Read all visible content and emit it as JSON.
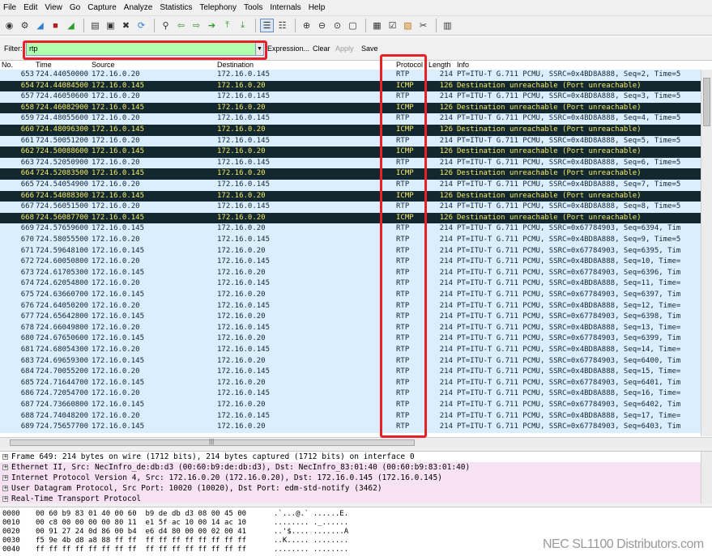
{
  "menu": [
    "File",
    "Edit",
    "View",
    "Go",
    "Capture",
    "Analyze",
    "Statistics",
    "Telephony",
    "Tools",
    "Internals",
    "Help"
  ],
  "filter": {
    "label": "Filter:",
    "value": "rtp",
    "expression": "Expression...",
    "clear": "Clear",
    "apply": "Apply",
    "save": "Save"
  },
  "columns": {
    "no": "No.",
    "time": "Time",
    "source": "Source",
    "destination": "Destination",
    "protocol": "Protocol",
    "length": "Length",
    "info": "Info"
  },
  "packets": [
    {
      "no": "653",
      "time": "724.44050000",
      "src": "172.16.0.20",
      "dst": "172.16.0.145",
      "proto": "RTP",
      "len": "214",
      "info": "PT=ITU-T G.711 PCMU, SSRC=0x4BD8A888, Seq=2, Time=5"
    },
    {
      "no": "654",
      "time": "724.44084500",
      "src": "172.16.0.145",
      "dst": "172.16.0.20",
      "proto": "ICMP",
      "len": "126",
      "info": "Destination unreachable (Port unreachable)"
    },
    {
      "no": "657",
      "time": "724.46050600",
      "src": "172.16.0.20",
      "dst": "172.16.0.145",
      "proto": "RTP",
      "len": "214",
      "info": "PT=ITU-T G.711 PCMU, SSRC=0x4BD8A888, Seq=3, Time=5"
    },
    {
      "no": "658",
      "time": "724.46082900",
      "src": "172.16.0.145",
      "dst": "172.16.0.20",
      "proto": "ICMP",
      "len": "126",
      "info": "Destination unreachable (Port unreachable)"
    },
    {
      "no": "659",
      "time": "724.48055600",
      "src": "172.16.0.20",
      "dst": "172.16.0.145",
      "proto": "RTP",
      "len": "214",
      "info": "PT=ITU-T G.711 PCMU, SSRC=0x4BD8A888, Seq=4, Time=5"
    },
    {
      "no": "660",
      "time": "724.48096300",
      "src": "172.16.0.145",
      "dst": "172.16.0.20",
      "proto": "ICMP",
      "len": "126",
      "info": "Destination unreachable (Port unreachable)"
    },
    {
      "no": "661",
      "time": "724.50051200",
      "src": "172.16.0.20",
      "dst": "172.16.0.145",
      "proto": "RTP",
      "len": "214",
      "info": "PT=ITU-T G.711 PCMU, SSRC=0x4BD8A888, Seq=5, Time=5"
    },
    {
      "no": "662",
      "time": "724.50088600",
      "src": "172.16.0.145",
      "dst": "172.16.0.20",
      "proto": "ICMP",
      "len": "126",
      "info": "Destination unreachable (Port unreachable)"
    },
    {
      "no": "663",
      "time": "724.52050900",
      "src": "172.16.0.20",
      "dst": "172.16.0.145",
      "proto": "RTP",
      "len": "214",
      "info": "PT=ITU-T G.711 PCMU, SSRC=0x4BD8A888, Seq=6, Time=5"
    },
    {
      "no": "664",
      "time": "724.52083500",
      "src": "172.16.0.145",
      "dst": "172.16.0.20",
      "proto": "ICMP",
      "len": "126",
      "info": "Destination unreachable (Port unreachable)"
    },
    {
      "no": "665",
      "time": "724.54054900",
      "src": "172.16.0.20",
      "dst": "172.16.0.145",
      "proto": "RTP",
      "len": "214",
      "info": "PT=ITU-T G.711 PCMU, SSRC=0x4BD8A888, Seq=7, Time=5"
    },
    {
      "no": "666",
      "time": "724.54088300",
      "src": "172.16.0.145",
      "dst": "172.16.0.20",
      "proto": "ICMP",
      "len": "126",
      "info": "Destination unreachable (Port unreachable)"
    },
    {
      "no": "667",
      "time": "724.56051500",
      "src": "172.16.0.20",
      "dst": "172.16.0.145",
      "proto": "RTP",
      "len": "214",
      "info": "PT=ITU-T G.711 PCMU, SSRC=0x4BD8A888, Seq=8, Time=5"
    },
    {
      "no": "668",
      "time": "724.56087700",
      "src": "172.16.0.145",
      "dst": "172.16.0.20",
      "proto": "ICMP",
      "len": "126",
      "info": "Destination unreachable (Port unreachable)"
    },
    {
      "no": "669",
      "time": "724.57659600",
      "src": "172.16.0.145",
      "dst": "172.16.0.20",
      "proto": "RTP",
      "len": "214",
      "info": "PT=ITU-T G.711 PCMU, SSRC=0x67784903, Seq=6394, Tim"
    },
    {
      "no": "670",
      "time": "724.58055500",
      "src": "172.16.0.20",
      "dst": "172.16.0.145",
      "proto": "RTP",
      "len": "214",
      "info": "PT=ITU-T G.711 PCMU, SSRC=0x4BD8A888, Seq=9, Time=5"
    },
    {
      "no": "671",
      "time": "724.59648100",
      "src": "172.16.0.145",
      "dst": "172.16.0.20",
      "proto": "RTP",
      "len": "214",
      "info": "PT=ITU-T G.711 PCMU, SSRC=0x67784903, Seq=6395, Tim"
    },
    {
      "no": "672",
      "time": "724.60050800",
      "src": "172.16.0.20",
      "dst": "172.16.0.145",
      "proto": "RTP",
      "len": "214",
      "info": "PT=ITU-T G.711 PCMU, SSRC=0x4BD8A888, Seq=10, Time="
    },
    {
      "no": "673",
      "time": "724.61705300",
      "src": "172.16.0.145",
      "dst": "172.16.0.20",
      "proto": "RTP",
      "len": "214",
      "info": "PT=ITU-T G.711 PCMU, SSRC=0x67784903, Seq=6396, Tim"
    },
    {
      "no": "674",
      "time": "724.62054800",
      "src": "172.16.0.20",
      "dst": "172.16.0.145",
      "proto": "RTP",
      "len": "214",
      "info": "PT=ITU-T G.711 PCMU, SSRC=0x4BD8A888, Seq=11, Time="
    },
    {
      "no": "675",
      "time": "724.63660700",
      "src": "172.16.0.145",
      "dst": "172.16.0.20",
      "proto": "RTP",
      "len": "214",
      "info": "PT=ITU-T G.711 PCMU, SSRC=0x67784903, Seq=6397, Tim"
    },
    {
      "no": "676",
      "time": "724.64050200",
      "src": "172.16.0.20",
      "dst": "172.16.0.145",
      "proto": "RTP",
      "len": "214",
      "info": "PT=ITU-T G.711 PCMU, SSRC=0x4BD8A888, Seq=12, Time="
    },
    {
      "no": "677",
      "time": "724.65642800",
      "src": "172.16.0.145",
      "dst": "172.16.0.20",
      "proto": "RTP",
      "len": "214",
      "info": "PT=ITU-T G.711 PCMU, SSRC=0x67784903, Seq=6398, Tim"
    },
    {
      "no": "678",
      "time": "724.66049800",
      "src": "172.16.0.20",
      "dst": "172.16.0.145",
      "proto": "RTP",
      "len": "214",
      "info": "PT=ITU-T G.711 PCMU, SSRC=0x4BD8A888, Seq=13, Time="
    },
    {
      "no": "680",
      "time": "724.67650600",
      "src": "172.16.0.145",
      "dst": "172.16.0.20",
      "proto": "RTP",
      "len": "214",
      "info": "PT=ITU-T G.711 PCMU, SSRC=0x67784903, Seq=6399, Tim"
    },
    {
      "no": "681",
      "time": "724.68054300",
      "src": "172.16.0.20",
      "dst": "172.16.0.145",
      "proto": "RTP",
      "len": "214",
      "info": "PT=ITU-T G.711 PCMU, SSRC=0x4BD8A888, Seq=14, Time="
    },
    {
      "no": "683",
      "time": "724.69659300",
      "src": "172.16.0.145",
      "dst": "172.16.0.20",
      "proto": "RTP",
      "len": "214",
      "info": "PT=ITU-T G.711 PCMU, SSRC=0x67784903, Seq=6400, Tim"
    },
    {
      "no": "684",
      "time": "724.70055200",
      "src": "172.16.0.20",
      "dst": "172.16.0.145",
      "proto": "RTP",
      "len": "214",
      "info": "PT=ITU-T G.711 PCMU, SSRC=0x4BD8A888, Seq=15, Time="
    },
    {
      "no": "685",
      "time": "724.71644700",
      "src": "172.16.0.145",
      "dst": "172.16.0.20",
      "proto": "RTP",
      "len": "214",
      "info": "PT=ITU-T G.711 PCMU, SSRC=0x67784903, Seq=6401, Tim"
    },
    {
      "no": "686",
      "time": "724.72054700",
      "src": "172.16.0.20",
      "dst": "172.16.0.145",
      "proto": "RTP",
      "len": "214",
      "info": "PT=ITU-T G.711 PCMU, SSRC=0x4BD8A888, Seq=16, Time="
    },
    {
      "no": "687",
      "time": "724.73660800",
      "src": "172.16.0.145",
      "dst": "172.16.0.20",
      "proto": "RTP",
      "len": "214",
      "info": "PT=ITU-T G.711 PCMU, SSRC=0x67784903, Seq=6402, Tim"
    },
    {
      "no": "688",
      "time": "724.74048200",
      "src": "172.16.0.20",
      "dst": "172.16.0.145",
      "proto": "RTP",
      "len": "214",
      "info": "PT=ITU-T G.711 PCMU, SSRC=0x4BD8A888, Seq=17, Time="
    },
    {
      "no": "689",
      "time": "724.75657700",
      "src": "172.16.0.145",
      "dst": "172.16.0.20",
      "proto": "RTP",
      "len": "214",
      "info": "PT=ITU-T G.711 PCMU, SSRC=0x67784903, Seq=6403, Tim"
    }
  ],
  "details": [
    "Frame 649: 214 bytes on wire (1712 bits), 214 bytes captured (1712 bits) on interface 0",
    "Ethernet II, Src: NecInfro_de:db:d3 (00:60:b9:de:db:d3), Dst: NecInfro_83:01:40 (00:60:b9:83:01:40)",
    "Internet Protocol Version 4, Src: 172.16.0.20 (172.16.0.20), Dst: 172.16.0.145 (172.16.0.145)",
    "User Datagram Protocol, Src Port: 10020 (10020), Dst Port: edm-std-notify (3462)",
    "Real-Time Transport Protocol"
  ],
  "bytes": [
    {
      "off": "0000",
      "hex": "00 60 b9 83 01 40 00 60  b9 de db d3 08 00 45 00",
      "ascii": ".`...@.` ......E."
    },
    {
      "off": "0010",
      "hex": "00 c8 00 00 00 00 80 11  e1 5f ac 10 00 14 ac 10",
      "ascii": "........ ._......"
    },
    {
      "off": "0020",
      "hex": "00 91 27 24 0d 86 00 b4  e6 d4 80 00 00 02 00 41",
      "ascii": "..'$.... .......A"
    },
    {
      "off": "0030",
      "hex": "f5 9e 4b d8 a8 88 ff ff  ff ff ff ff ff ff ff ff",
      "ascii": "..K..... ........"
    },
    {
      "off": "0040",
      "hex": "ff ff ff ff ff ff ff ff  ff ff ff ff ff ff ff ff",
      "ascii": "........ ........"
    }
  ],
  "watermark": "NEC SL1100 Distributors.com",
  "colors": {
    "rtp_row_bg": "#daeeff",
    "icmp_row_bg": "#12272e",
    "icmp_row_fg": "#f7ea68",
    "filter_valid_bg": "#afffaf",
    "highlight": "#e8202a"
  },
  "toolbar_icons": [
    "interface-list-icon",
    "capture-options-icon",
    "start-capture-icon",
    "stop-capture-icon",
    "restart-capture-icon",
    "open-file-icon",
    "save-file-icon",
    "close-file-icon",
    "reload-icon",
    "find-icon",
    "back-icon",
    "forward-icon",
    "go-to-packet-icon",
    "first-packet-icon",
    "last-packet-icon",
    "colorize-icon",
    "zoom-in-icon",
    "zoom-out-icon",
    "zoom-normal-icon",
    "resize-columns-icon",
    "capture-filters-icon",
    "display-filters-icon",
    "coloring-rules-icon",
    "preferences-icon",
    "help-icon"
  ]
}
